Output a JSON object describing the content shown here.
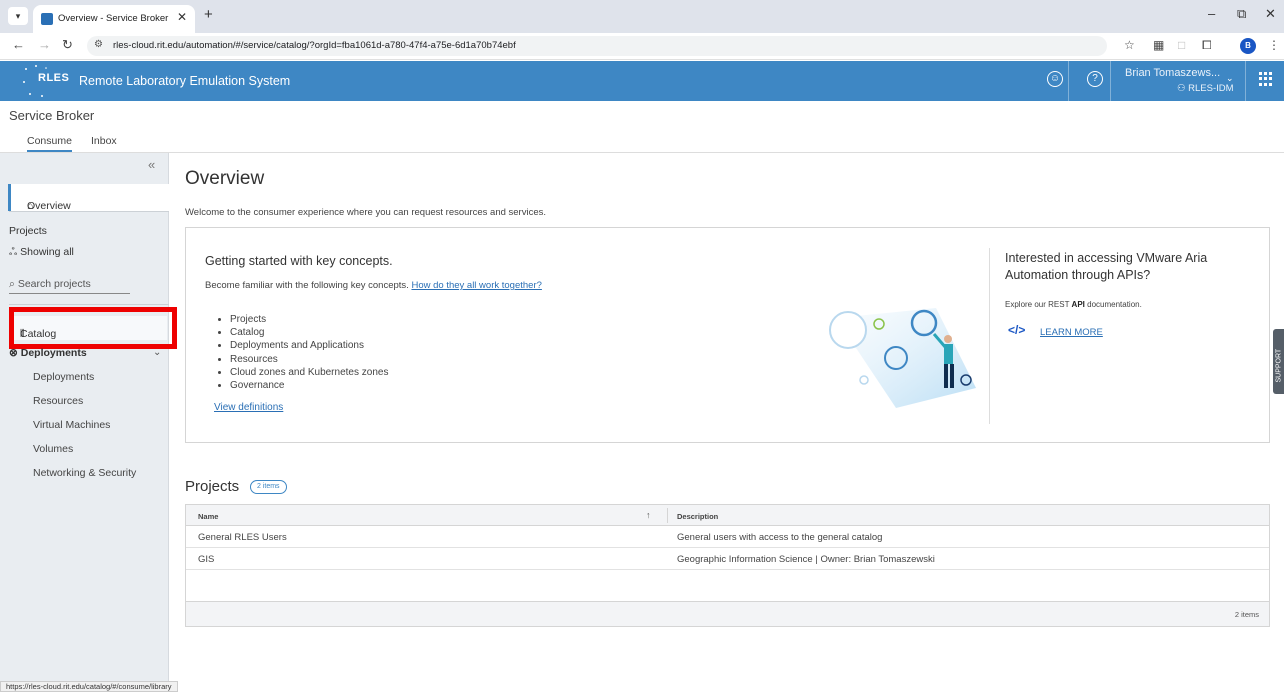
{
  "browser": {
    "tab_title": "Overview - Service Broker",
    "url": "rles-cloud.rit.edu/automation/#/service/catalog/?orgId=fba1061d-a780-47f4-a75e-6d1a70b74ebf",
    "profile_initial": "B",
    "status_url": "https://rles-cloud.rit.edu/catalog/#/consume/library"
  },
  "header": {
    "logo": "RLES",
    "title": "Remote Laboratory Emulation System",
    "user_name": "Brian Tomaszews...",
    "user_org": "RLES-IDM",
    "brand_color": "#3e87c4"
  },
  "subheader": {
    "title": "Service Broker",
    "tabs": [
      "Consume",
      "Inbox"
    ]
  },
  "sidebar": {
    "overview": "Overview",
    "projects_label": "Projects",
    "showing_all": "Showing all",
    "search_placeholder": "Search projects",
    "catalog": "Catalog",
    "deployments_group": "Deployments",
    "sub_items": [
      "Deployments",
      "Resources",
      "Virtual Machines",
      "Volumes",
      "Networking & Security"
    ]
  },
  "main": {
    "title": "Overview",
    "welcome": "Welcome to the consumer experience where you can request resources and services.",
    "card": {
      "title": "Getting started with key concepts.",
      "desc": "Become familiar with the following key concepts.",
      "desc_link": "How do they all work together?",
      "concepts": [
        "Projects",
        "Catalog",
        "Deployments and Applications",
        "Resources",
        "Cloud zones and Kubernetes zones",
        "Governance"
      ],
      "view_definitions": "View definitions",
      "api_title": "Interested in accessing VMware Aria Automation through APIs?",
      "api_desc_pre": "Explore our REST ",
      "api_desc_bold": "API",
      "api_desc_post": " documentation.",
      "api_icon": "</>",
      "learn_more": "LEARN MORE"
    },
    "support": "SUPPORT",
    "projects": {
      "title": "Projects",
      "badge": "2 items",
      "col_name": "Name",
      "col_desc": "Description",
      "rows": [
        {
          "name": "General RLES Users",
          "desc": "General users with access to the general catalog"
        },
        {
          "name": "GIS",
          "desc": "Geographic Information Science | Owner: Brian Tomaszewski"
        }
      ],
      "footer": "2 items"
    }
  }
}
